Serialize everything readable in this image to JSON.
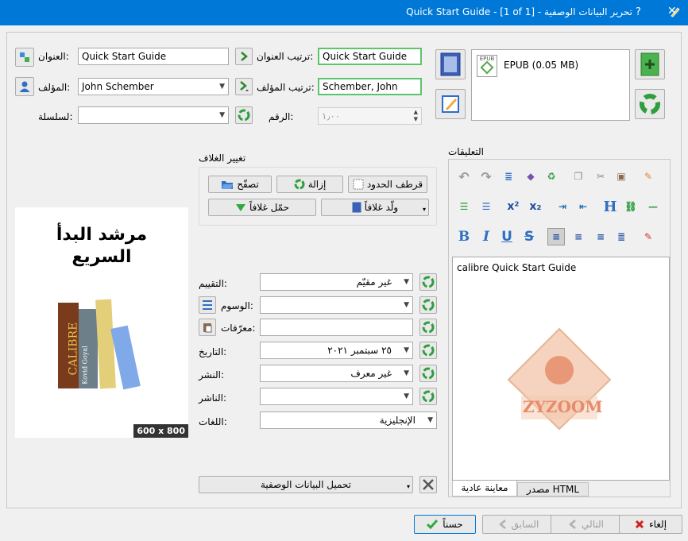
{
  "window": {
    "title": "تحرير البيانات الوصفية - Quick Start Guide -  [1 of 1]",
    "help": "?",
    "close": "✕"
  },
  "form": {
    "title_label": "العنوان:",
    "title_value": "Quick Start Guide",
    "title_sort_label": "ترتيب العنوان:",
    "title_sort_value": "Quick Start Guide",
    "author_label": "المؤلف:",
    "author_value": "John Schember",
    "author_sort_label": "ترتيب المؤلف:",
    "author_sort_value": "Schember, John",
    "series_label": "لسلسلة:",
    "series_value": "",
    "number_label": "الرقم:",
    "number_value": "١٫٠٠"
  },
  "formats": {
    "item": "EPUB (0.05 MB)",
    "badge": "EPUB"
  },
  "cover": {
    "group_title": "تغيير الغلاف",
    "browse": "تصفّح",
    "remove": "إزالة",
    "trim": "قرطف الحدود",
    "download": "حمّل غلافاً",
    "generate": "ولّد غلافاً",
    "book_title_line1": "مرشد البدأ",
    "book_title_line2": "السريع",
    "spine1": "CALIBRE",
    "spine2": "Kovid Goyal",
    "size": "600 x 800"
  },
  "meta": {
    "rating_label": "التقييم:",
    "rating_value": "غير مقيّم",
    "tags_label": "الوسوم:",
    "tags_value": "",
    "ids_label": "معرّفات:",
    "ids_value": "",
    "date_label": "التاريخ:",
    "date_value": "٢٥ سبتمبر ٢٠٢١",
    "published_label": "النشر:",
    "published_value": "غير معرف",
    "publisher_label": "الناشر:",
    "publisher_value": "",
    "languages_label": "اللغات:",
    "languages_value": "الإنجليزية",
    "download_metadata": "تحميل البيانات الوصفية"
  },
  "comments": {
    "title": "التعليقات",
    "content": "calibre Quick Start Guide",
    "tab_normal": "معاينة عادية",
    "tab_html": "مصدر HTML",
    "watermark": "ZYZOOM"
  },
  "buttons": {
    "ok": "حسناً",
    "prev": "السابق",
    "next": "التالي",
    "cancel": "إلغاء"
  },
  "colors": {
    "titlebar": "#0078d7",
    "green_border": "#5ec46a",
    "recycle_green": "#2e9e3e"
  }
}
